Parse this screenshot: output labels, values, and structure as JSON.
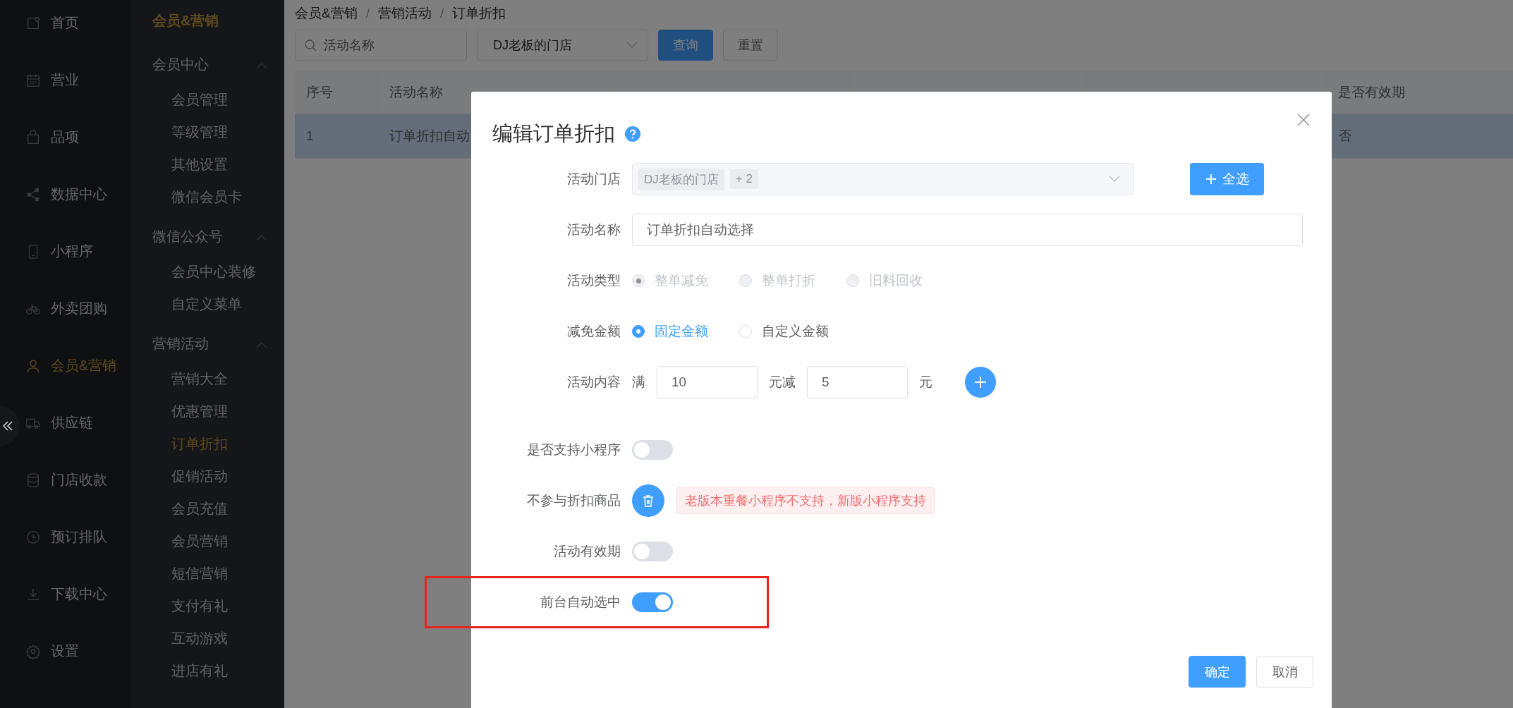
{
  "nav": [
    {
      "label": "首页",
      "selected": false
    },
    {
      "label": "营业",
      "selected": false
    },
    {
      "label": "品项",
      "selected": false
    },
    {
      "label": "数据中心",
      "selected": false
    },
    {
      "label": "小程序",
      "selected": false
    },
    {
      "label": "外卖团购",
      "selected": false
    },
    {
      "label": "会员&营销",
      "selected": true
    },
    {
      "label": "供应链",
      "selected": false
    },
    {
      "label": "门店收款",
      "selected": false
    },
    {
      "label": "预订排队",
      "selected": false
    },
    {
      "label": "下载中心",
      "selected": false
    },
    {
      "label": "设置",
      "selected": false
    }
  ],
  "submenu": {
    "title": "会员&营销",
    "groups": [
      {
        "label": "会员中心",
        "expanded": true,
        "children": [
          {
            "label": "会员管理",
            "selected": false
          },
          {
            "label": "等级管理",
            "selected": false
          },
          {
            "label": "其他设置",
            "selected": false
          },
          {
            "label": "微信会员卡",
            "selected": false
          }
        ]
      },
      {
        "label": "微信公众号",
        "expanded": true,
        "children": [
          {
            "label": "会员中心装修",
            "selected": false
          },
          {
            "label": "自定义菜单",
            "selected": false
          }
        ]
      },
      {
        "label": "营销活动",
        "expanded": true,
        "children": [
          {
            "label": "营销大全",
            "selected": false
          },
          {
            "label": "优惠管理",
            "selected": false
          },
          {
            "label": "订单折扣",
            "selected": true
          },
          {
            "label": "促销活动",
            "selected": false
          },
          {
            "label": "会员充值",
            "selected": false
          },
          {
            "label": "会员营销",
            "selected": false
          },
          {
            "label": "短信营销",
            "selected": false
          },
          {
            "label": "支付有礼",
            "selected": false
          },
          {
            "label": "互动游戏",
            "selected": false
          },
          {
            "label": "进店有礼",
            "selected": false
          }
        ]
      }
    ]
  },
  "breadcrumb": {
    "separator": "/",
    "items": [
      "会员&营销",
      "营销活动",
      "订单折扣"
    ]
  },
  "toolbar": {
    "search": {
      "placeholder": "活动名称"
    },
    "store_select": {
      "value": "DJ老板的门店"
    },
    "buttons": [
      {
        "label": "查询",
        "kind": "primary"
      },
      {
        "label": "重置",
        "kind": "default"
      }
    ]
  },
  "table": {
    "columns": [
      "序号",
      "活动名称",
      "是否有效期"
    ],
    "rows": [
      {
        "cells": [
          "1",
          "订单折扣自动",
          "否"
        ],
        "highlighted": true
      }
    ]
  },
  "dialog": {
    "title": "编辑订单折扣",
    "fields": [
      {
        "kind": "multiselect",
        "label": "活动门店",
        "disabled": true,
        "tags": [
          "DJ老板的门店",
          "+ 2"
        ],
        "button": "全选"
      },
      {
        "kind": "text",
        "label": "活动名称",
        "value": "订单折扣自动选择"
      },
      {
        "kind": "radio",
        "label": "活动类型",
        "disabled": true,
        "options": [
          {
            "label": "整单减免",
            "selected": true
          },
          {
            "label": "整单打折",
            "selected": false
          },
          {
            "label": "旧料回收",
            "selected": false
          }
        ]
      },
      {
        "kind": "radio",
        "label": "减免金额",
        "disabled": false,
        "options": [
          {
            "label": "固定金额",
            "selected": true
          },
          {
            "label": "自定义金额",
            "selected": false
          }
        ]
      },
      {
        "kind": "amounts",
        "label": "活动内容",
        "parts": [
          {
            "kind": "text",
            "text": "满"
          },
          {
            "kind": "input",
            "value": "10"
          },
          {
            "kind": "text",
            "text": "元减"
          },
          {
            "kind": "input",
            "value": "5"
          },
          {
            "kind": "text",
            "text": "元"
          },
          {
            "kind": "add"
          }
        ]
      },
      {
        "kind": "switch",
        "label": "是否支持小程序",
        "on": false,
        "highlighted": false
      },
      {
        "kind": "goods",
        "label": "不参与折扣商品",
        "notice": "老版本重餐小程序不支持，新版小程序支持"
      },
      {
        "kind": "switch",
        "label": "活动有效期",
        "on": false,
        "highlighted": false
      },
      {
        "kind": "switch",
        "label": "前台自动选中",
        "on": true,
        "highlighted": true
      }
    ],
    "buttons": [
      {
        "label": "确定",
        "kind": "primary"
      },
      {
        "label": "取消",
        "kind": "default"
      }
    ]
  }
}
